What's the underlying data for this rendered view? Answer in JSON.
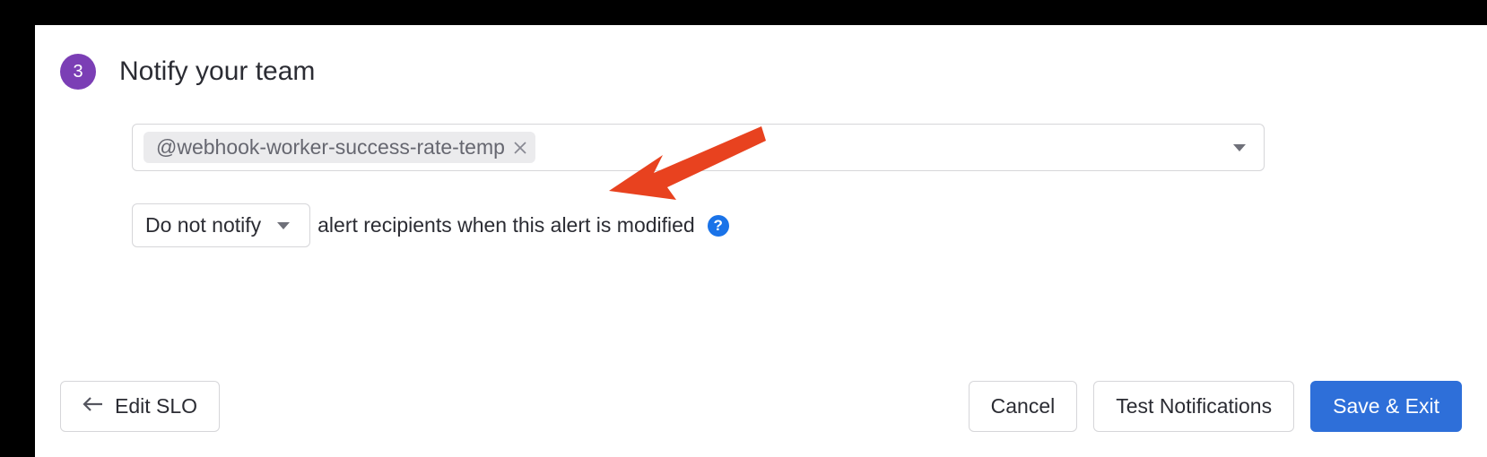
{
  "step": {
    "number": "3",
    "title": "Notify your team"
  },
  "recipients": {
    "tag": "@webhook-worker-success-rate-temp"
  },
  "notify": {
    "select_value": "Do not notify",
    "description": "alert recipients when this alert is modified"
  },
  "footer": {
    "back_label": "Edit SLO",
    "cancel_label": "Cancel",
    "test_label": "Test Notifications",
    "save_label": "Save & Exit"
  }
}
